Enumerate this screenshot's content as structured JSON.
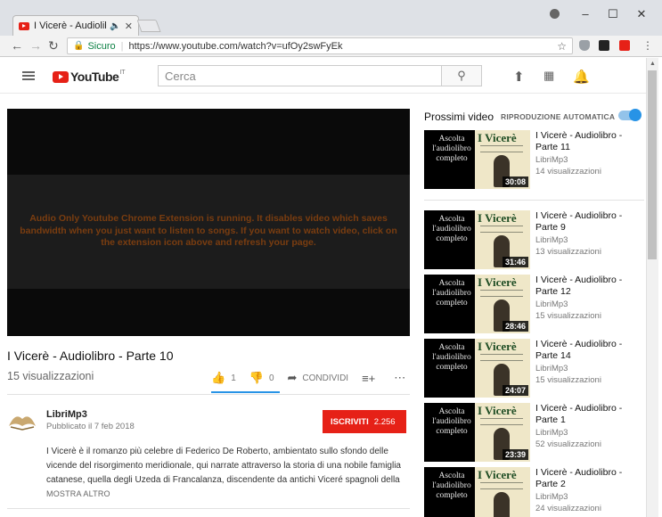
{
  "browser": {
    "tab_title": "I Vicerè - Audiolibro",
    "secure_label": "Sicuro",
    "url": "https://www.youtube.com/watch?v=ufOy2swFyEk"
  },
  "header": {
    "logo_text": "YouTube",
    "country_code": "IT",
    "search_placeholder": "Cerca"
  },
  "player": {
    "message": "Audio Only Youtube Chrome Extension is running. It disables video which saves bandwidth when you just want to listen to songs. If you want to watch video, click on the extension icon above and refresh your page."
  },
  "video": {
    "title": "I Vicerè - Audiolibro - Parte 10",
    "views": "15 visualizzazioni",
    "likes": "1",
    "dislikes": "0",
    "share_label": "CONDIVIDI"
  },
  "channel": {
    "name": "LibriMp3",
    "published": "Pubblicato il 7 feb 2018",
    "subscribe_label": "ISCRIVITI",
    "subscriber_count": "2.256"
  },
  "description": {
    "text": "I Vicerè è il romanzo più celebre di Federico De Roberto, ambientato sullo sfondo delle vicende del risorgimento meridionale, qui narrate attraverso la storia di una nobile famiglia catanese, quella degli Uzeda di Francalanza, discendente da antichi Viceré spagnoli della",
    "show_more": "MOSTRA ALTRO"
  },
  "sidebar": {
    "up_next_label": "Prossimi video",
    "autoplay_label": "RIPRODUZIONE AUTOMATICA",
    "thumbnail_text": "Ascolta l'audiolibro completo",
    "cover_title": "I Vicerè",
    "items": [
      {
        "title": "I Vicerè - Audiolibro - Parte 11",
        "channel": "LibriMp3",
        "views": "14 visualizzazioni",
        "duration": "30:08"
      },
      {
        "title": "I Vicerè - Audiolibro - Parte 9",
        "channel": "LibriMp3",
        "views": "13 visualizzazioni",
        "duration": "31:46"
      },
      {
        "title": "I Vicerè - Audiolibro - Parte 12",
        "channel": "LibriMp3",
        "views": "15 visualizzazioni",
        "duration": "28:46"
      },
      {
        "title": "I Vicerè - Audiolibro - Parte 14",
        "channel": "LibriMp3",
        "views": "15 visualizzazioni",
        "duration": "24:07"
      },
      {
        "title": "I Vicerè - Audiolibro - Parte 1",
        "channel": "LibriMp3",
        "views": "52 visualizzazioni",
        "duration": "23:39"
      },
      {
        "title": "I Vicerè - Audiolibro - Parte 2",
        "channel": "LibriMp3",
        "views": "24 visualizzazioni",
        "duration": ""
      }
    ]
  },
  "colors": {
    "brand_red": "#e62117",
    "accent_blue": "#2793e6",
    "player_message": "#7a3d10"
  }
}
